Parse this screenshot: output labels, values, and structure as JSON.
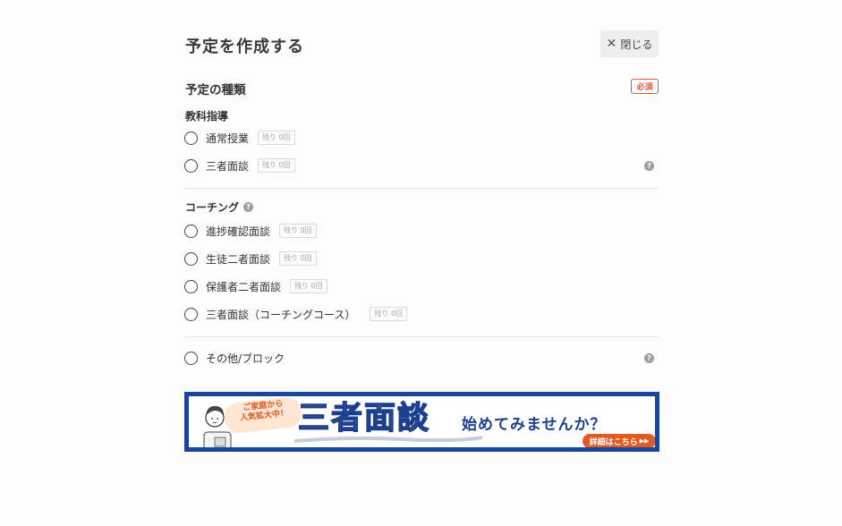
{
  "header": {
    "title": "予定を作成する",
    "close_label": "閉じる",
    "close_icon": "close-icon"
  },
  "schedule_type": {
    "title": "予定の種類",
    "required_badge": "必須"
  },
  "groups": [
    {
      "title": "教科指導",
      "options": [
        {
          "label": "通常授業",
          "remaining": "残り 0回"
        },
        {
          "label": "三者面談",
          "remaining": "残り 0回"
        }
      ]
    },
    {
      "title": "コーチング",
      "options": [
        {
          "label": "進捗確認面談",
          "remaining": "残り 0回"
        },
        {
          "label": "生徒二者面談",
          "remaining": "残り 0回"
        },
        {
          "label": "保護者二者面談",
          "remaining": "残り 0回"
        },
        {
          "label": "三者面談（コーチングコース）",
          "remaining": "残り 0回"
        }
      ]
    }
  ],
  "other": {
    "label": "その他/ブロック"
  },
  "help_icon_text": "?",
  "banner": {
    "bubble_line1": "ご家庭から",
    "bubble_line2": "人気拡大中！",
    "headline": "三者面談",
    "subline": "始めてみませんか？",
    "cta": "詳細はこちら",
    "colors": {
      "frame": "#17479a",
      "headline": "#f5d030",
      "cta": "#e35a21"
    }
  }
}
